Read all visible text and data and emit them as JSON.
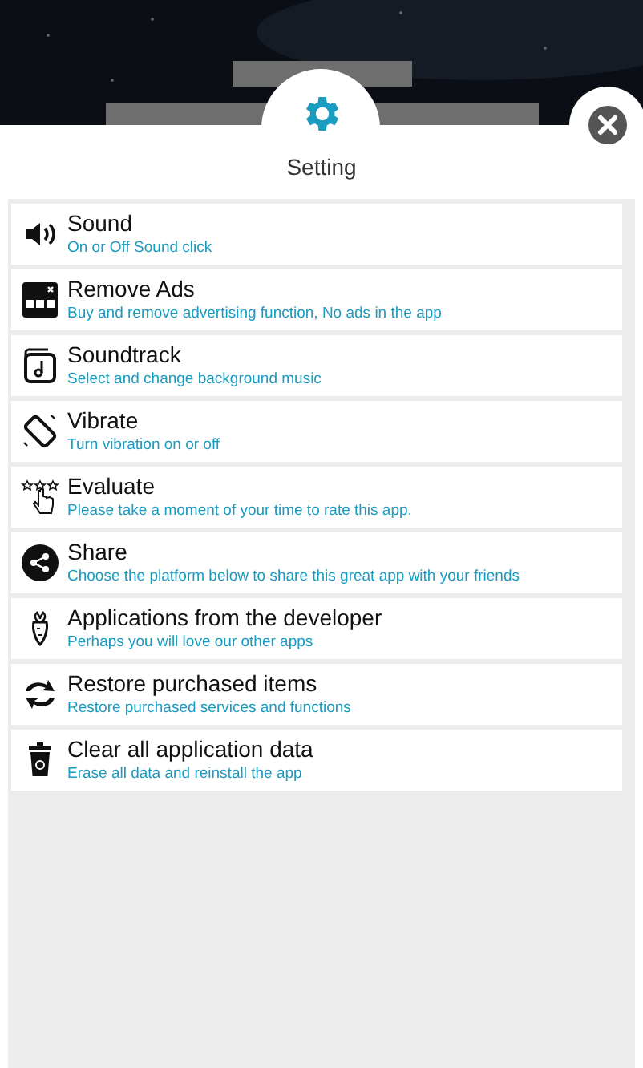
{
  "dialog": {
    "title": "Setting"
  },
  "items": [
    {
      "title": "Sound",
      "subtitle": "On or Off Sound click"
    },
    {
      "title": "Remove Ads",
      "subtitle": "Buy and remove advertising function, No ads in the app"
    },
    {
      "title": "Soundtrack",
      "subtitle": "Select and change background music"
    },
    {
      "title": "Vibrate",
      "subtitle": "Turn vibration on or off"
    },
    {
      "title": "Evaluate",
      "subtitle": "Please take a moment of your time to rate this app."
    },
    {
      "title": "Share",
      "subtitle": "Choose the platform below to share this great app with your friends"
    },
    {
      "title": "Applications from the developer",
      "subtitle": "Perhaps you will love our other apps"
    },
    {
      "title": "Restore purchased items",
      "subtitle": "Restore purchased services and functions"
    },
    {
      "title": "Clear all application data",
      "subtitle": "Erase all data and reinstall the app"
    }
  ]
}
